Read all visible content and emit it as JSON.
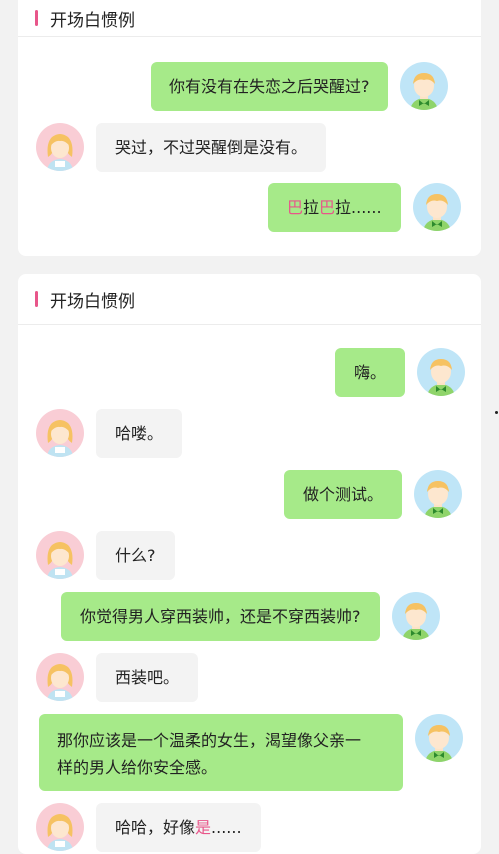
{
  "colors": {
    "accent": "#e8568a",
    "sent_bubble": "#a6ea89",
    "received_bubble": "#f3f3f3",
    "background": "#f2f2f2"
  },
  "cards": [
    {
      "title": "开场白惯例",
      "messages": [
        {
          "from": "me",
          "text": "你有没有在失恋之后哭醒过?"
        },
        {
          "from": "her",
          "text": "哭过，不过哭醒倒是没有。"
        },
        {
          "from": "me",
          "parts": [
            "巴",
            "拉",
            "巴",
            "拉......"
          ]
        }
      ]
    },
    {
      "title": "开场白惯例",
      "messages": [
        {
          "from": "me",
          "text": "嗨。"
        },
        {
          "from": "her",
          "text": "哈喽。"
        },
        {
          "from": "me",
          "text": "做个测试。"
        },
        {
          "from": "her",
          "text": "什么?"
        },
        {
          "from": "me",
          "text": "你觉得男人穿西装帅，还是不穿西装帅?"
        },
        {
          "from": "her",
          "text": "西装吧。"
        },
        {
          "from": "me",
          "lines": [
            "那你应该是一个温柔的女生，渴望像父亲一",
            "样的男人给你安全感。"
          ]
        },
        {
          "from": "her",
          "parts": [
            "哈哈，好像",
            "是",
            "......"
          ]
        }
      ]
    }
  ]
}
